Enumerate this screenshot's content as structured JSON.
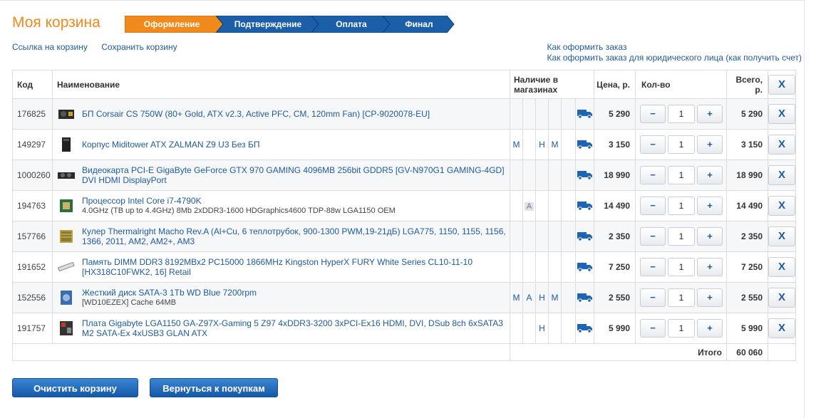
{
  "page": {
    "title": "Моя корзина"
  },
  "steps": [
    {
      "label": "Оформление",
      "active": true
    },
    {
      "label": "Подтверждение",
      "active": false
    },
    {
      "label": "Оплата",
      "active": false
    },
    {
      "label": "Финал",
      "active": false
    }
  ],
  "links": {
    "cart_link": "Ссылка на корзину",
    "save_cart": "Сохранить корзину",
    "how_to_order": "Как оформить заказ",
    "how_to_order_legal": "Как оформить заказ для юридического лица (как получить счет)"
  },
  "table": {
    "headers": {
      "code": "Код",
      "name": "Наименование",
      "stores": "Наличие в магазинах",
      "price": "Цена, р.",
      "qty": "Кол-во",
      "total": "Всего, р.",
      "delete": "X"
    },
    "rows": [
      {
        "code": "176825",
        "name": "БП Corsair CS 750W (80+ Gold, ATX v2.3, Active PFC, CM, 120mm Fan) [CP-9020078-EU]",
        "sub": "",
        "stores": [
          "",
          "",
          "",
          ""
        ],
        "price": "5 290",
        "qty": "1",
        "total": "5 290"
      },
      {
        "code": "149297",
        "name": "Корпус Miditower ATX ZALMAN Z9 U3 Без БП",
        "sub": "",
        "stores": [
          "М",
          "",
          "Н",
          "М"
        ],
        "price": "3 150",
        "qty": "1",
        "total": "3 150"
      },
      {
        "code": "1000260",
        "name": "Видеокарта PCI-E GigaByte GeForce GTX 970 GAMING 4096MB 256bit GDDR5 [GV-N970G1 GAMING-4GD] DVI HDMI DisplayPort",
        "sub": "",
        "stores": [
          "",
          "",
          "",
          ""
        ],
        "price": "18 990",
        "qty": "1",
        "total": "18 990"
      },
      {
        "code": "194763",
        "name": "Процессор Intel Core i7-4790K",
        "sub": "4.0GHz (TB up to 4.4GHz) 8Mb 2xDDR3-1600 HDGraphics4600 TDP-88w LGA1150 OEM",
        "stores": [
          "",
          "А",
          "",
          ""
        ],
        "price": "14 490",
        "qty": "1",
        "total": "14 490"
      },
      {
        "code": "157766",
        "name": "Кулер Thermalright Macho Rev.A (Al+Cu, 6 теплотрубок, 900-1300 PWM,19-21дБ) LGA775, 1150, 1155, 1156, 1366, 2011, AM2, AM2+, AM3",
        "sub": "",
        "stores": [
          "",
          "",
          "",
          ""
        ],
        "price": "2 350",
        "qty": "1",
        "total": "2 350"
      },
      {
        "code": "191652",
        "name": "Память DIMM DDR3 8192MBx2 PC15000 1866MHz Kingston HyperX FURY White Series CL10-11-10 [HX318C10FWK2, 16] Retail",
        "sub": "",
        "stores": [
          "",
          "",
          "",
          ""
        ],
        "price": "7 250",
        "qty": "1",
        "total": "7 250"
      },
      {
        "code": "152556",
        "name": "Жесткий диск SATA-3 1Tb WD Blue 7200rpm",
        "sub": "[WD10EZEX] Cache 64MB",
        "stores": [
          "М",
          "А",
          "Н",
          "М"
        ],
        "price": "2 550",
        "qty": "1",
        "total": "2 550"
      },
      {
        "code": "191757",
        "name": "Плата Gigabyte LGA1150 GA-Z97X-Gaming 5 Z97 4xDDR3-3200 3xPCI-Ex16 HDMI, DVI, DSub 8ch 6xSATA3 M2 SATA-Ex 4xUSB3 GLAN ATX",
        "sub": "",
        "stores": [
          "",
          "",
          "Н",
          ""
        ],
        "price": "5 990",
        "qty": "1",
        "total": "5 990"
      }
    ],
    "qty_minus": "−",
    "qty_plus": "+",
    "delete_label": "X",
    "total_label": "Итого",
    "total_value": "60 060"
  },
  "buttons": {
    "clear_cart": "Очистить корзину",
    "back_to_shopping": "Вернуться к покупкам"
  },
  "colors": {
    "accent_orange": "#f08a1c",
    "step_blue": "#1b5fa8",
    "link_blue": "#1e5a9c"
  }
}
